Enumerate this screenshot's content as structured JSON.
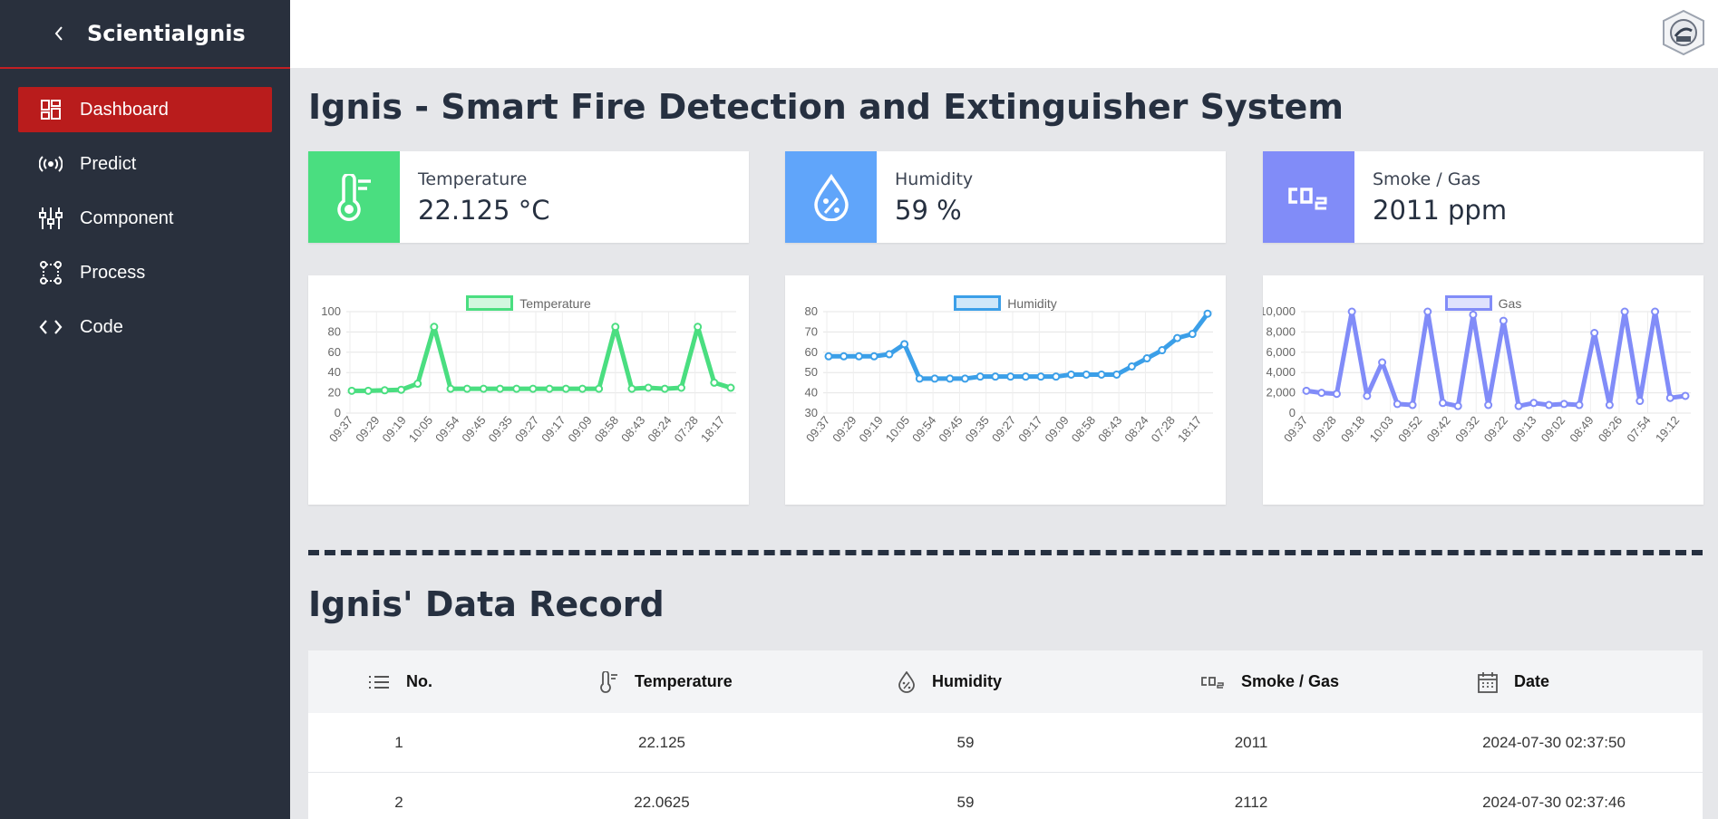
{
  "app": {
    "title": "ScientiaIgnis"
  },
  "sidebar": {
    "items": [
      {
        "label": "Dashboard",
        "icon": "dashboard-icon",
        "active": true
      },
      {
        "label": "Predict",
        "icon": "broadcast-icon",
        "active": false
      },
      {
        "label": "Component",
        "icon": "sliders-icon",
        "active": false
      },
      {
        "label": "Process",
        "icon": "process-icon",
        "active": false
      },
      {
        "label": "Code",
        "icon": "code-icon",
        "active": false
      }
    ]
  },
  "colors": {
    "sidebar": "#29303d",
    "active": "#b91c1c",
    "temperature": "#4ade80",
    "humidity": "#60a5fa",
    "gas": "#818cf8"
  },
  "main": {
    "title": "Ignis - Smart Fire Detection and Extinguisher System",
    "stats": [
      {
        "label": "Temperature",
        "value": "22.125 °C",
        "icon": "thermometer-icon"
      },
      {
        "label": "Humidity",
        "value": "59 %",
        "icon": "humidity-drop-icon"
      },
      {
        "label": "Smoke / Gas",
        "value": "2011 ppm",
        "icon": "co2-icon"
      }
    ],
    "record_title": "Ignis' Data Record"
  },
  "chart_data": [
    {
      "type": "line",
      "series": [
        {
          "name": "Temperature",
          "values": [
            22,
            22,
            22.5,
            23,
            29,
            85,
            24,
            24,
            24,
            24,
            24,
            24,
            24,
            24,
            24,
            24,
            85,
            24,
            25,
            24,
            25,
            85,
            30,
            25
          ]
        }
      ],
      "x_tick_labels": [
        "09:37",
        "09:29",
        "09:19",
        "10:05",
        "09:54",
        "09:45",
        "09:35",
        "09:27",
        "09:17",
        "09:09",
        "08:58",
        "08:43",
        "08:24",
        "07:28",
        "18:17"
      ],
      "y_ticks": [
        "100",
        "80",
        "60",
        "40",
        "20",
        "0"
      ],
      "ylim": [
        0,
        100
      ]
    },
    {
      "type": "line",
      "series": [
        {
          "name": "Humidity",
          "values": [
            58,
            58,
            58,
            58,
            59,
            64,
            47,
            47,
            47,
            47,
            48,
            48,
            48,
            48,
            48,
            48,
            49,
            49,
            49,
            49,
            53,
            57,
            61,
            67,
            69,
            79
          ]
        }
      ],
      "x_tick_labels": [
        "09:37",
        "09:29",
        "09:19",
        "10:05",
        "09:54",
        "09:45",
        "09:35",
        "09:27",
        "09:17",
        "09:09",
        "08:58",
        "08:43",
        "08:24",
        "07:28",
        "18:17"
      ],
      "y_ticks": [
        "80",
        "70",
        "60",
        "50",
        "40",
        "30"
      ],
      "ylim": [
        30,
        80
      ]
    },
    {
      "type": "line",
      "series": [
        {
          "name": "Gas",
          "values": [
            2200,
            2000,
            1900,
            10000,
            1700,
            5000,
            900,
            800,
            10000,
            1000,
            700,
            9700,
            800,
            9100,
            700,
            1000,
            800,
            900,
            800,
            7900,
            800,
            10000,
            1200,
            10000,
            1500,
            1700
          ]
        }
      ],
      "x_tick_labels": [
        "09:37",
        "09:28",
        "09:18",
        "10:03",
        "09:52",
        "09:42",
        "09:32",
        "09:22",
        "09:13",
        "09:02",
        "08:49",
        "08:26",
        "07:54",
        "19:12"
      ],
      "y_ticks": [
        "10,000",
        "8,000",
        "6,000",
        "4,000",
        "2,000",
        "0"
      ],
      "ylim": [
        0,
        10000
      ]
    }
  ],
  "table": {
    "headers": [
      "No.",
      "Temperature",
      "Humidity",
      "Smoke / Gas",
      "Date"
    ],
    "rows": [
      [
        "1",
        "22.125",
        "59",
        "2011",
        "2024-07-30 02:37:50"
      ],
      [
        "2",
        "22.0625",
        "59",
        "2112",
        "2024-07-30 02:37:46"
      ]
    ]
  }
}
